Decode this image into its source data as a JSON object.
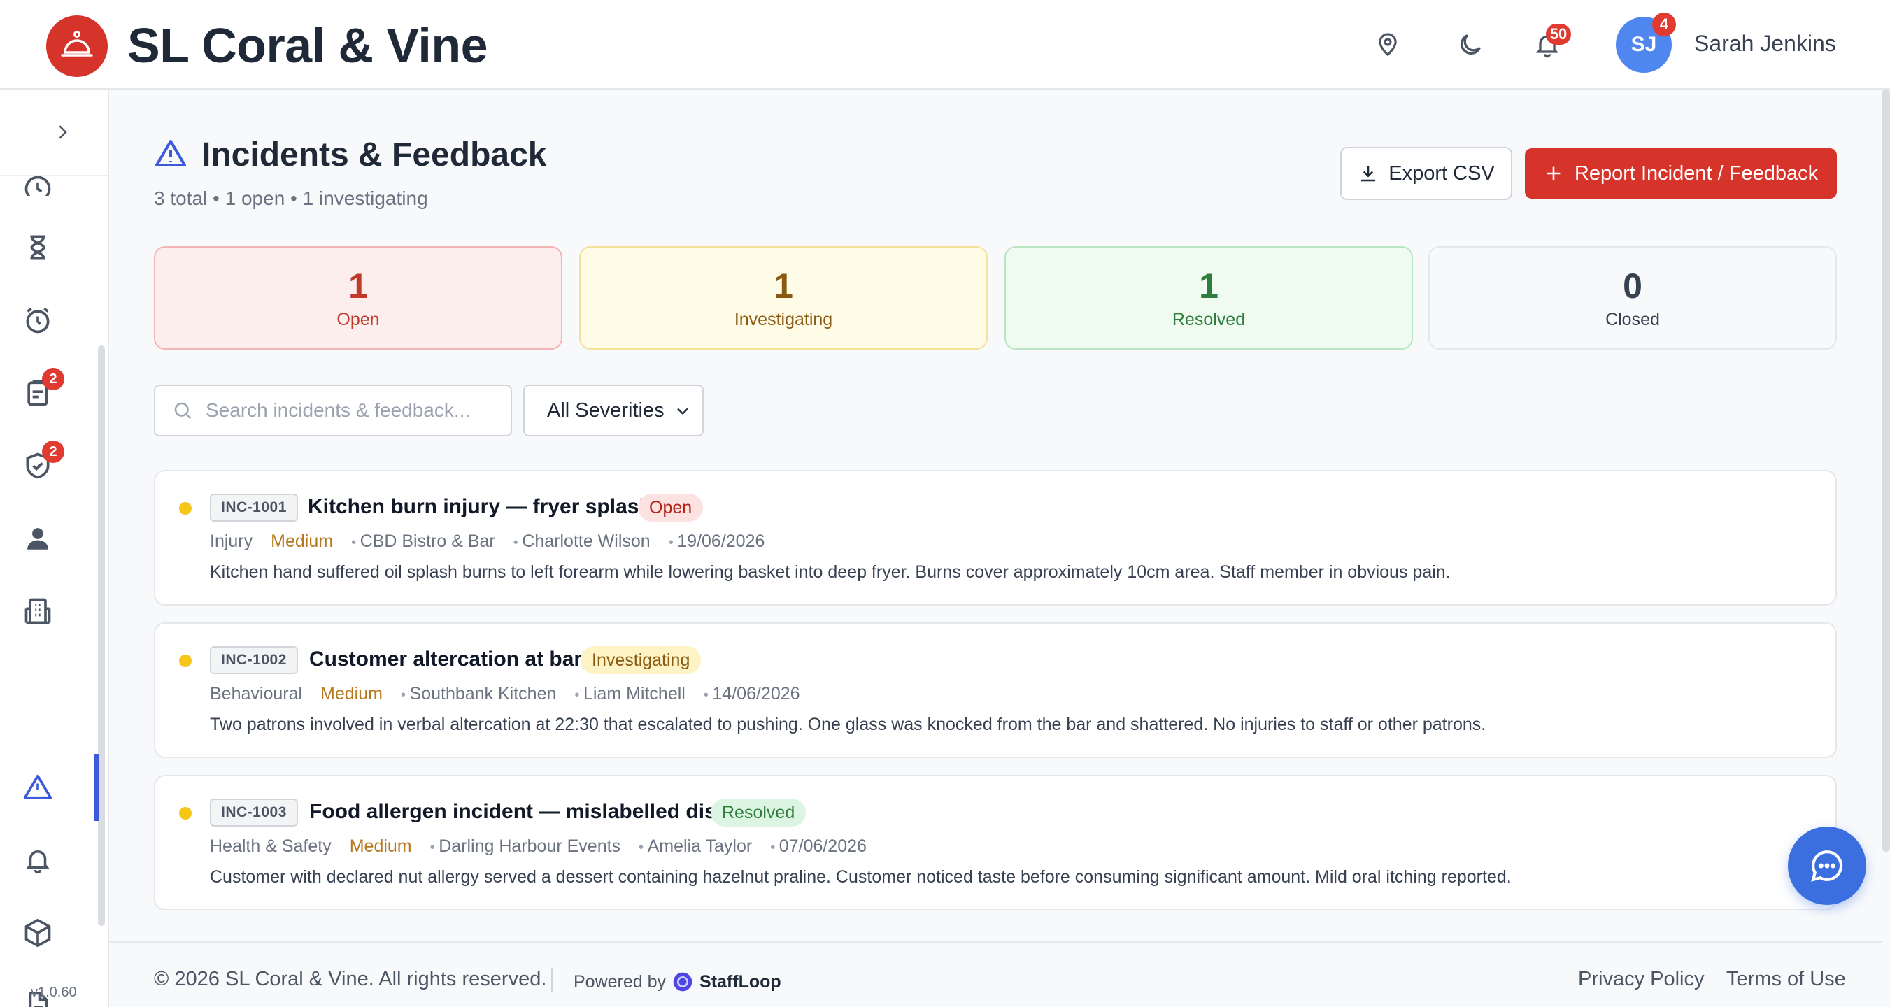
{
  "header": {
    "brand": "SL Coral & Vine",
    "notification_count": "50",
    "avatar_initials": "SJ",
    "avatar_badge": "4",
    "user_name": "Sarah Jenkins"
  },
  "sidebar": {
    "version": "v1.0.60",
    "badges": {
      "clipboard": "2",
      "shield": "2"
    },
    "items": [
      "clock-icon",
      "hourglass-icon",
      "alarm-icon",
      "clipboard-icon",
      "shield-check-icon",
      "person-icon",
      "building-icon",
      "warning-icon",
      "bell-icon",
      "box-icon",
      "document-icon"
    ]
  },
  "page": {
    "title": "Incidents & Feedback",
    "subtitle": "3 total • 1 open • 1 investigating",
    "export_label": "Export CSV",
    "report_label": "Report Incident / Feedback"
  },
  "stats": [
    {
      "value": "1",
      "label": "Open",
      "bg": "#fdeeee",
      "border": "#f3b6b6",
      "color": "#c0392b"
    },
    {
      "value": "1",
      "label": "Investigating",
      "bg": "#fefbe6",
      "border": "#f3e39a",
      "color": "#8a5a13"
    },
    {
      "value": "1",
      "label": "Resolved",
      "bg": "#effbf1",
      "border": "#b9e6c2",
      "color": "#2f7d3c"
    },
    {
      "value": "0",
      "label": "Closed",
      "bg": "#f8f9fb",
      "border": "#e5e7eb",
      "color": "#374151"
    }
  ],
  "filters": {
    "search_placeholder": "Search incidents & feedback...",
    "severity_selected": "All Severities"
  },
  "incidents": [
    {
      "code": "INC-1001",
      "title": "Kitchen burn injury — fryer splash",
      "status": "Open",
      "category": "Injury",
      "severity": "Medium",
      "location": "CBD Bistro & Bar",
      "person": "Charlotte Wilson",
      "date": "19/06/2026",
      "description": "Kitchen hand suffered oil splash burns to left forearm while lowering basket into deep fryer. Burns cover approximately 10cm area. Staff member in obvious pain."
    },
    {
      "code": "INC-1002",
      "title": "Customer altercation at bar",
      "status": "Investigating",
      "category": "Behavioural",
      "severity": "Medium",
      "location": "Southbank Kitchen",
      "person": "Liam Mitchell",
      "date": "14/06/2026",
      "description": "Two patrons involved in verbal altercation at 22:30 that escalated to pushing. One glass was knocked from the bar and shattered. No injuries to staff or other patrons."
    },
    {
      "code": "INC-1003",
      "title": "Food allergen incident — mislabelled dish",
      "status": "Resolved",
      "category": "Health & Safety",
      "severity": "Medium",
      "location": "Darling Harbour Events",
      "person": "Amelia Taylor",
      "date": "07/06/2026",
      "description": "Customer with declared nut allergy served a dessert containing hazelnut praline. Customer noticed taste before consuming significant amount. Mild oral itching reported."
    }
  ],
  "footer": {
    "copyright": "© 2026 SL Coral & Vine. All rights reserved.",
    "powered_by": "Powered by",
    "powered_brand": "StaffLoop",
    "privacy": "Privacy Policy",
    "terms": "Terms of Use"
  },
  "colors": {
    "brand_red": "#d6332a",
    "accent_blue": "#3b5bdb",
    "severity_medium": "#b7791f",
    "status_open_bg": "#fde2e2",
    "status_open_fg": "#b42318",
    "status_investigating_bg": "#fdf3c4",
    "status_investigating_fg": "#8a5a13",
    "status_resolved_bg": "#dcf5e3",
    "status_resolved_fg": "#2f7d3c"
  }
}
